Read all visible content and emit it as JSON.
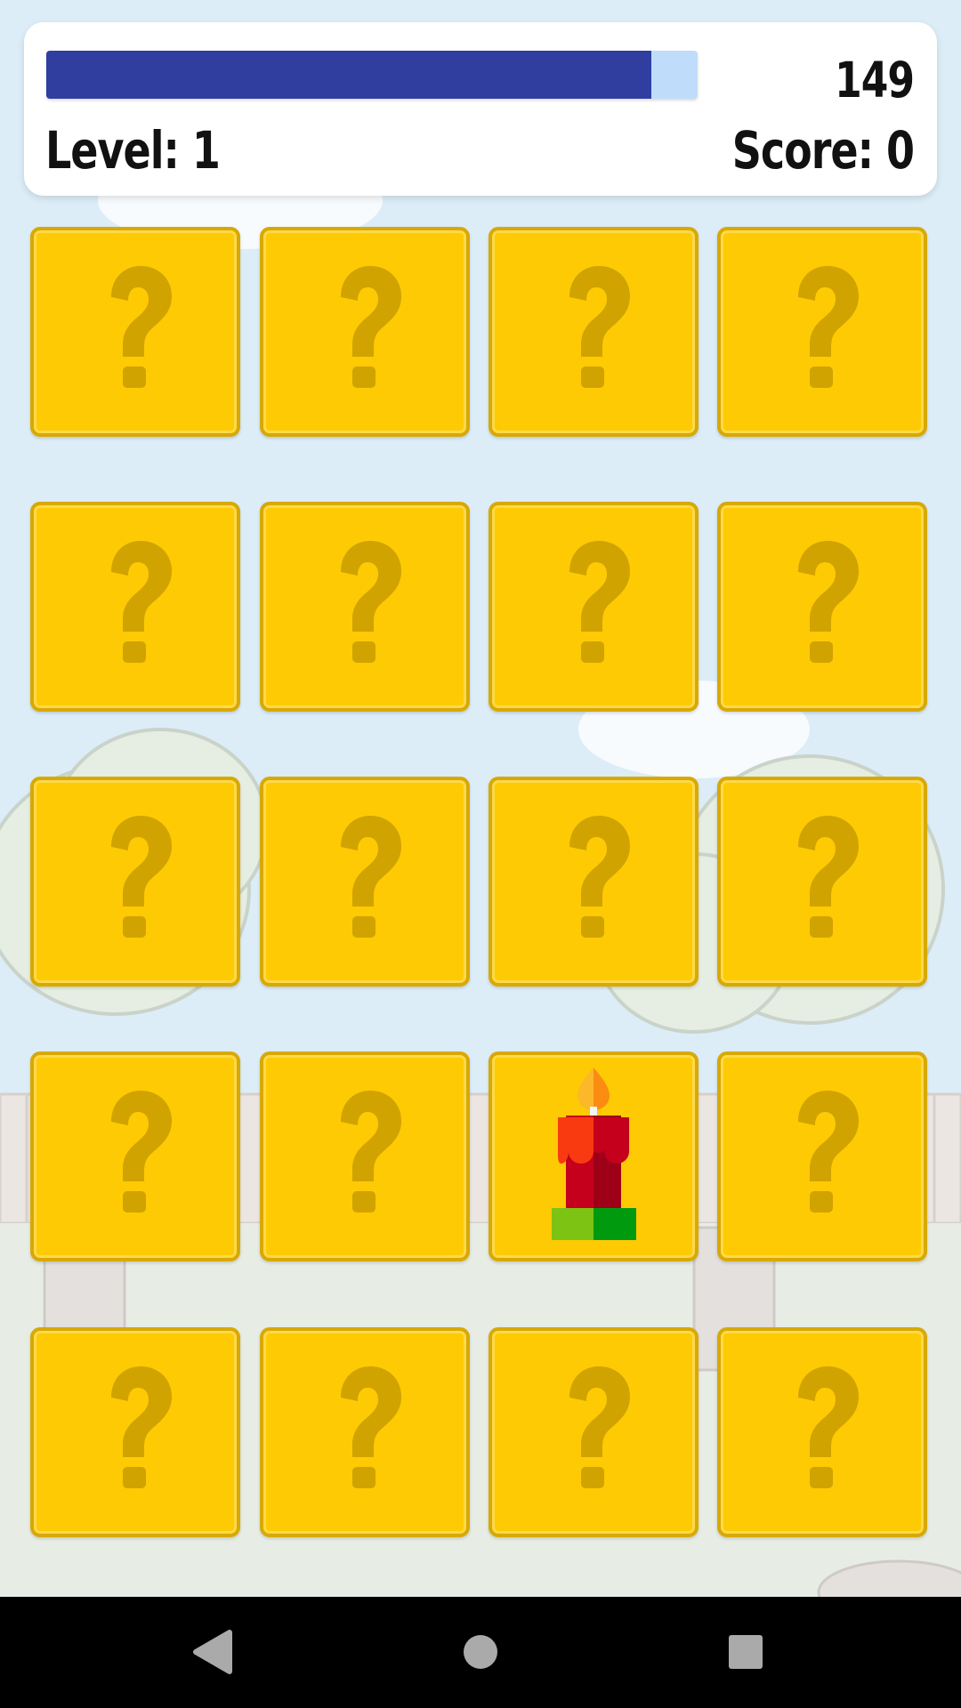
{
  "hud": {
    "time_remaining": "149",
    "time_progress": 0.929,
    "level_text": "Level: 1",
    "score_text": "Score: 0"
  },
  "board": {
    "rows": 5,
    "columns": 4,
    "cards": [
      {
        "state": "hidden",
        "icon": "question-mark-icon"
      },
      {
        "state": "hidden",
        "icon": "question-mark-icon"
      },
      {
        "state": "hidden",
        "icon": "question-mark-icon"
      },
      {
        "state": "hidden",
        "icon": "question-mark-icon"
      },
      {
        "state": "hidden",
        "icon": "question-mark-icon"
      },
      {
        "state": "hidden",
        "icon": "question-mark-icon"
      },
      {
        "state": "hidden",
        "icon": "question-mark-icon"
      },
      {
        "state": "hidden",
        "icon": "question-mark-icon"
      },
      {
        "state": "hidden",
        "icon": "question-mark-icon"
      },
      {
        "state": "hidden",
        "icon": "question-mark-icon"
      },
      {
        "state": "hidden",
        "icon": "question-mark-icon"
      },
      {
        "state": "hidden",
        "icon": "question-mark-icon"
      },
      {
        "state": "hidden",
        "icon": "question-mark-icon"
      },
      {
        "state": "hidden",
        "icon": "question-mark-icon"
      },
      {
        "state": "revealed",
        "icon": "candle-icon"
      },
      {
        "state": "hidden",
        "icon": "question-mark-icon"
      },
      {
        "state": "hidden",
        "icon": "question-mark-icon"
      },
      {
        "state": "hidden",
        "icon": "question-mark-icon"
      },
      {
        "state": "hidden",
        "icon": "question-mark-icon"
      },
      {
        "state": "hidden",
        "icon": "question-mark-icon"
      }
    ]
  },
  "colors": {
    "card_face": "#fdca04",
    "card_border": "#d8a905",
    "question_mark": "#d0a300",
    "timer_fill": "#2f3e9f",
    "timer_track": "#bfdcfb",
    "sky": "#dcedf8"
  },
  "navigation": {
    "back": "back-triangle-icon",
    "home": "home-circle-icon",
    "recents": "recents-square-icon"
  }
}
